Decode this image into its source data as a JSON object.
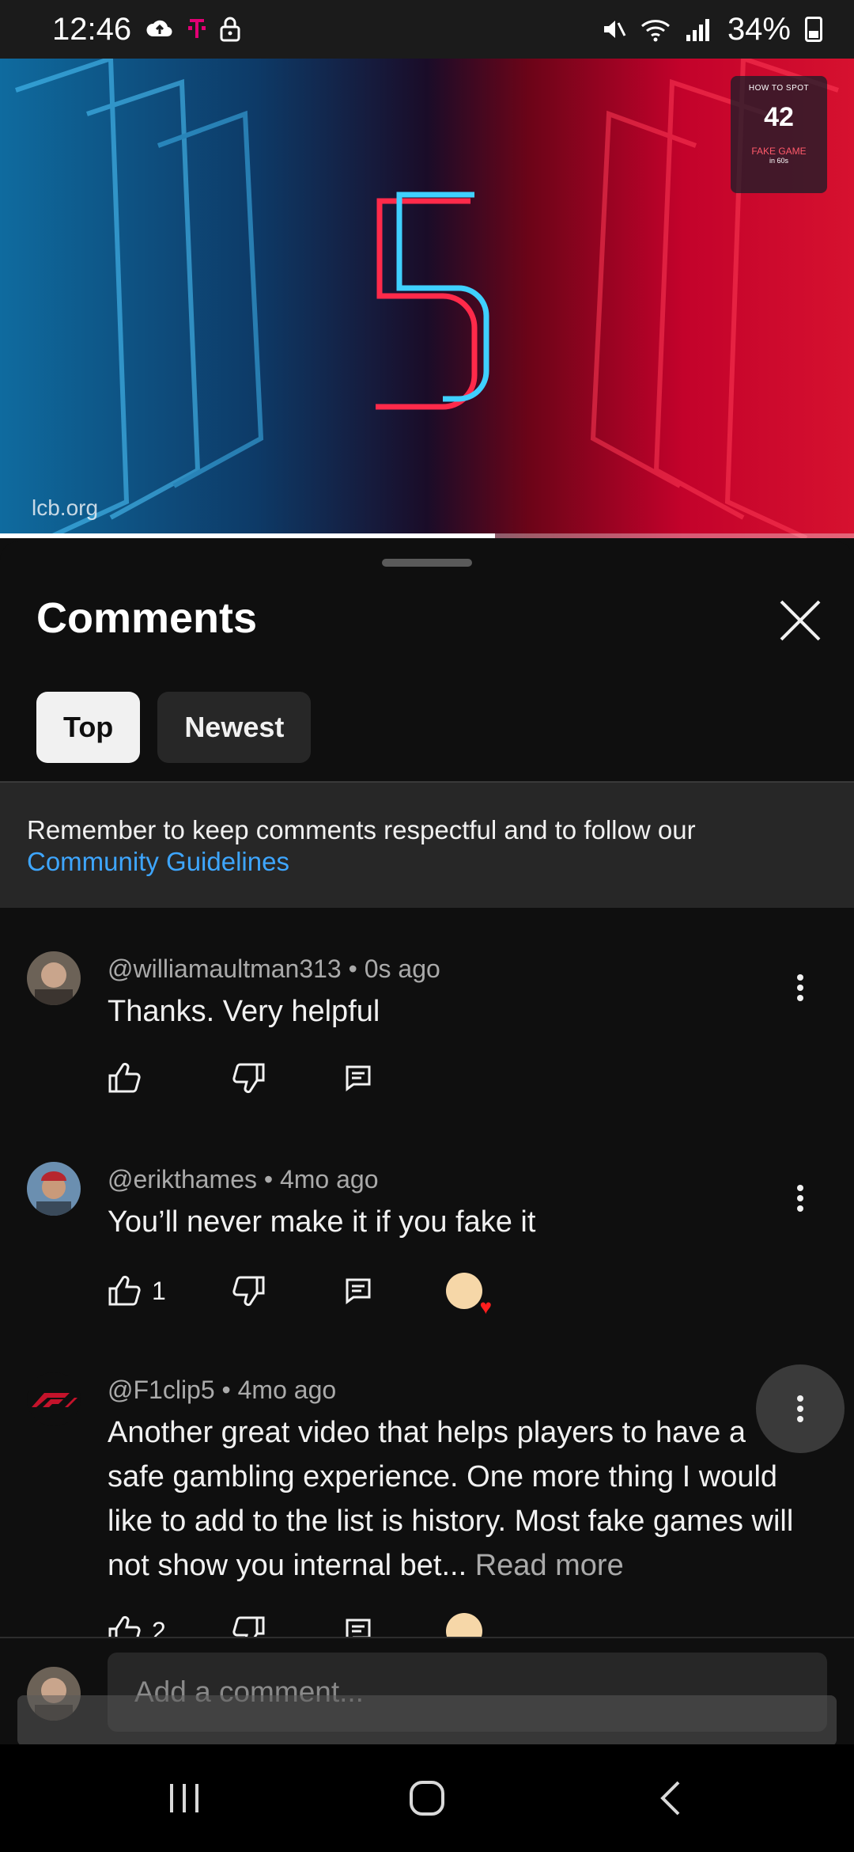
{
  "status_bar": {
    "time": "12:46",
    "battery": "34%",
    "left_icons": [
      "cloud-upload-icon",
      "t-mobile-icon",
      "lock-icon"
    ],
    "right_icons": [
      "mute-icon",
      "wifi-icon",
      "signal-icon",
      "battery-icon"
    ]
  },
  "video": {
    "watermark": "lcb.org",
    "badge_top": "HOW TO SPOT",
    "badge_number": "42",
    "badge_bottom": "FAKE GAME",
    "badge_sub": "in 60s",
    "progress_fraction": 0.58,
    "colors": {
      "left": "#0f6b9f",
      "right": "#d6112f"
    }
  },
  "comments_sheet": {
    "title": "Comments",
    "sort_chips": [
      {
        "label": "Top",
        "selected": true
      },
      {
        "label": "Newest",
        "selected": false
      }
    ],
    "notice_text": "Remember to keep comments respectful and to follow our",
    "notice_link": "Community Guidelines",
    "comments": [
      {
        "meta": "@williamaultman313 • 0s ago",
        "text": "Thanks. Very helpful",
        "likes": "",
        "creator_heart": false
      },
      {
        "meta": "@erikthames • 4mo ago",
        "text": "You’ll never make it if you fake it",
        "likes": "1",
        "creator_heart": true
      },
      {
        "meta": "@F1clip5 • 4mo ago",
        "text": "Another great video that helps players to have a safe gambling experience. One more thing I would like to add to the list is history. Most fake games will not show you internal bet...",
        "read_more": "Read more",
        "likes": "2",
        "creator_heart": true
      }
    ]
  },
  "composer": {
    "placeholder": "Add a comment..."
  },
  "nav_bar": {
    "buttons": [
      "recent-apps",
      "home",
      "back"
    ]
  },
  "colors": {
    "background": "#0f0f0f",
    "surface": "#272727",
    "link": "#3ea6ff",
    "heart": "#ff1e1e"
  }
}
